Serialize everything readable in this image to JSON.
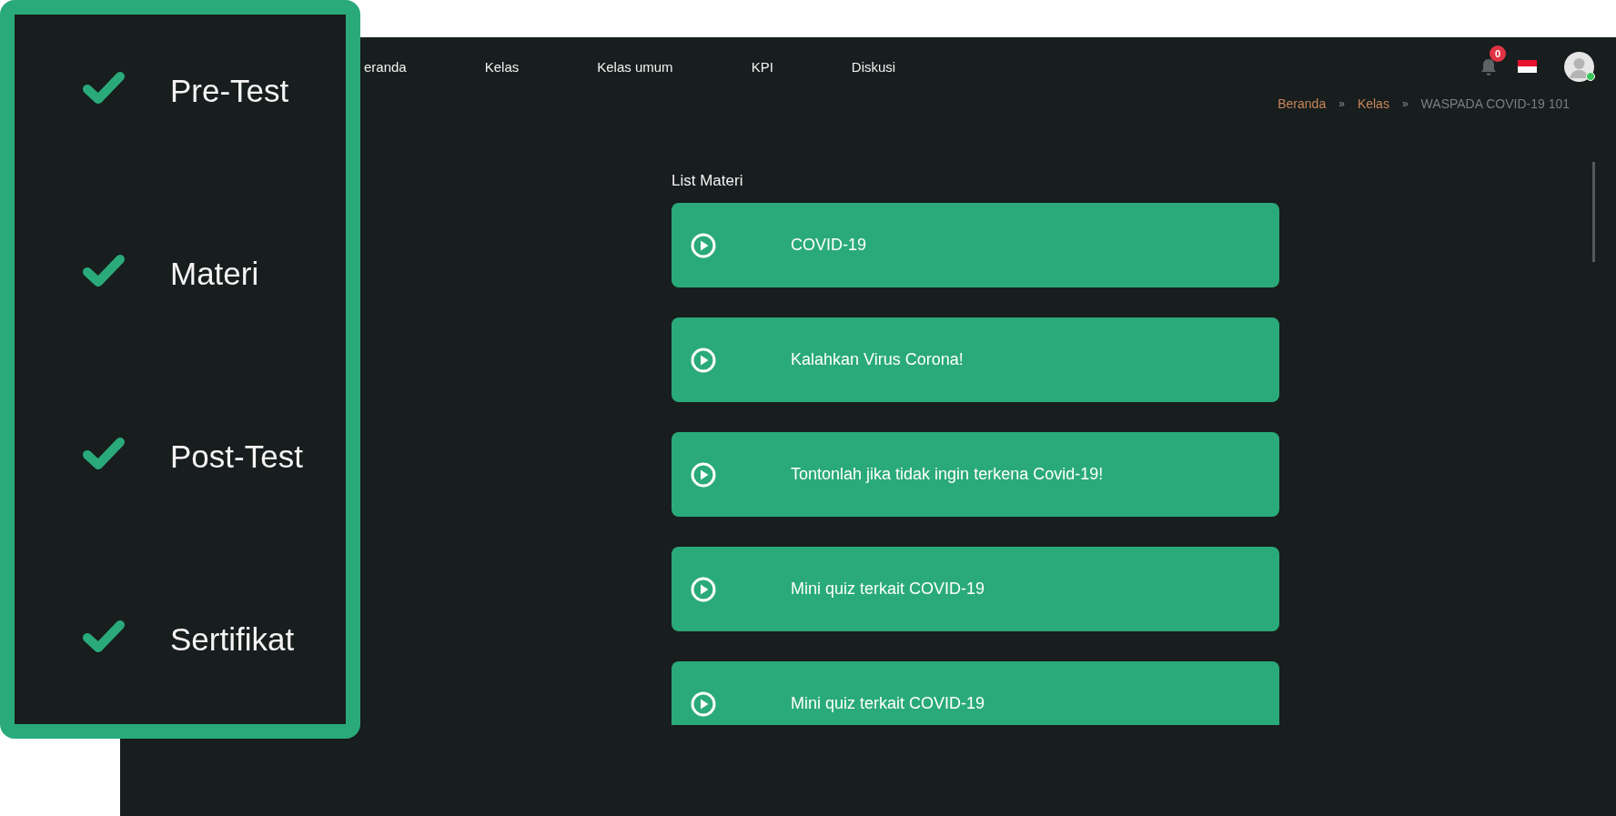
{
  "nav": {
    "items": [
      {
        "label": "eranda"
      },
      {
        "label": "Kelas"
      },
      {
        "label": "Kelas umum"
      },
      {
        "label": "KPI"
      },
      {
        "label": "Diskusi"
      }
    ],
    "notification_count": "0",
    "user": {
      "online": true
    }
  },
  "breadcrumb": [
    {
      "label": "Beranda",
      "kind": "link",
      "separator": "»"
    },
    {
      "label": "Kelas",
      "kind": "link",
      "separator": "»"
    },
    {
      "label": "WASPADA COVID-19 101",
      "kind": "current"
    }
  ],
  "steps": [
    {
      "label": "Pre-Test",
      "done": true
    },
    {
      "label": "Materi",
      "done": true
    },
    {
      "label": "Post-Test",
      "done": true
    },
    {
      "label": "Sertifikat",
      "done": true
    }
  ],
  "materi": {
    "title": "List Materi",
    "items": [
      {
        "label": "COVID-19"
      },
      {
        "label": "Kalahkan Virus Corona!"
      },
      {
        "label": "Tontonlah jika tidak ingin terkena Covid-19!"
      },
      {
        "label": "Mini quiz terkait COVID-19"
      },
      {
        "label": "Mini quiz terkait COVID-19"
      }
    ]
  }
}
